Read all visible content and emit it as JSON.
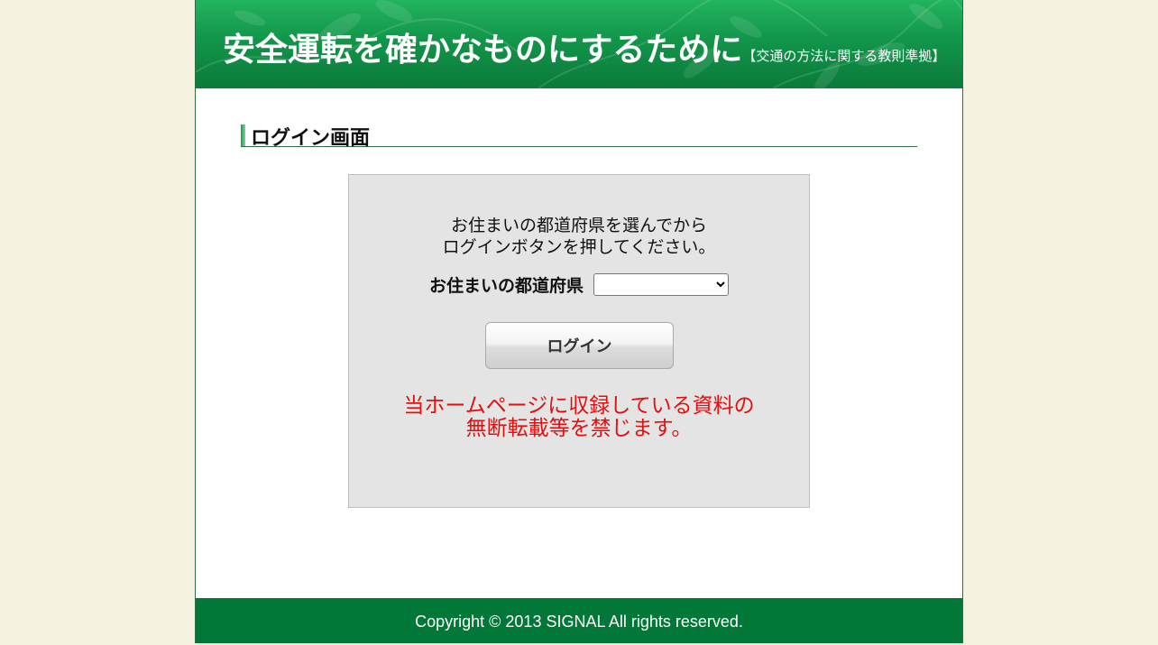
{
  "header": {
    "title": "安全運転を確かなものにするために",
    "subtitle": "【交通の方法に関する教則準拠】"
  },
  "section": {
    "title": "ログイン画面"
  },
  "login": {
    "instruction_line1": "お住まいの都道府県を選んでから",
    "instruction_line2": "ログインボタンを押してください。",
    "prefecture_label": "お住まいの都道府県",
    "prefecture_selected": "",
    "login_button": "ログイン",
    "notice_line1": "当ホームページに収録している資料の",
    "notice_line2": "無断転載等を禁じます。"
  },
  "footer": {
    "copyright": "Copyright © 2013 SIGNAL All rights reserved."
  },
  "colors": {
    "background": "#f5f1e0",
    "header_green": "#12954a",
    "footer_green": "#027838",
    "notice_red": "#e01010",
    "box_gray": "#e4e4e4"
  }
}
